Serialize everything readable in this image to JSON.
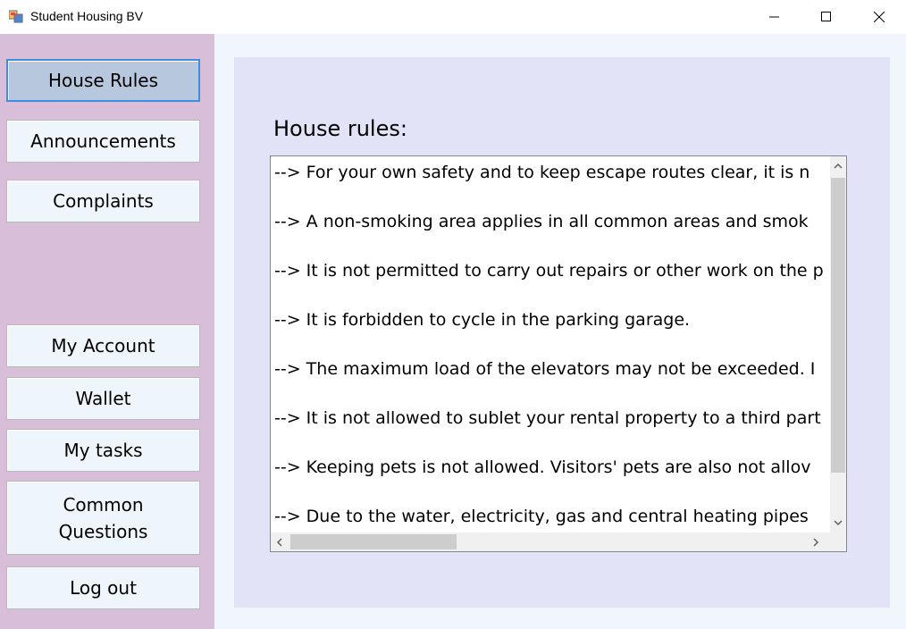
{
  "window": {
    "title": "Student Housing BV",
    "icon": "windows-forms-app-icon"
  },
  "sidebar": {
    "buttons": [
      {
        "label": "House Rules",
        "active": true
      },
      {
        "label": "Announcements"
      },
      {
        "label": "Complaints"
      },
      {
        "label": "My Account"
      },
      {
        "label": "Wallet"
      },
      {
        "label": "My tasks"
      },
      {
        "label": "Common\nQuestions"
      },
      {
        "label": "Log out"
      }
    ]
  },
  "main": {
    "heading": "House rules:",
    "rules": [
      "--> For your own safety and to keep escape routes clear, it is n",
      "--> A non-smoking area applies in all common areas and smok",
      "--> It is not permitted to carry out repairs or other work on the p",
      "--> It is forbidden to cycle in the parking garage.",
      "--> The maximum load of the elevators may not be exceeded. I",
      "--> It is not allowed to sublet your rental property to a third part",
      "--> Keeping pets is not allowed. Visitors' pets are also not allov",
      "--> Due to the water, electricity, gas and central heating pipes"
    ]
  },
  "colors": {
    "sidebar_bg": "#d8bed8",
    "panel_bg": "#e3e3f7",
    "active_button": "#b7c7dd",
    "active_border": "#3d8ee0"
  }
}
